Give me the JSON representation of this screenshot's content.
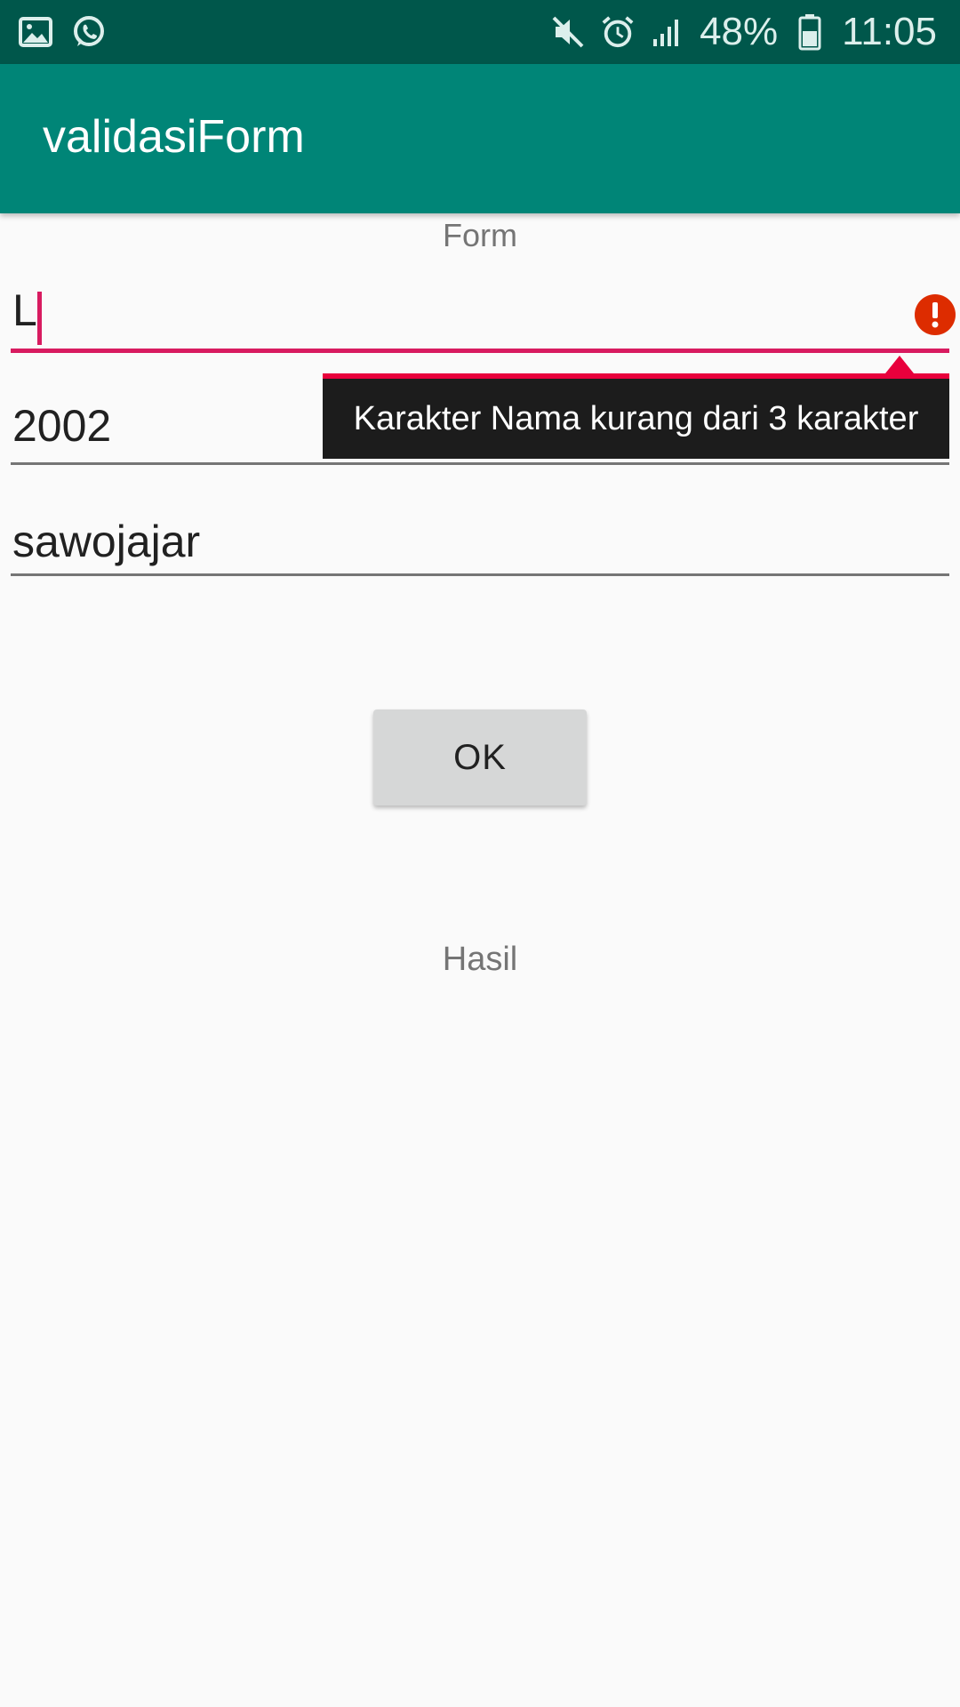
{
  "status_bar": {
    "battery_percent": "48%",
    "time": "11:05",
    "left_icons": [
      "gallery-icon",
      "whatsapp-icon"
    ],
    "right_icons": [
      "mute-icon",
      "alarm-icon",
      "signal-icon",
      "battery-icon"
    ]
  },
  "app_bar": {
    "title": "validasiForm",
    "color": "#008577"
  },
  "form": {
    "label": "Form",
    "name_field": {
      "value": "L"
    },
    "year_field": {
      "value": "2002"
    },
    "address_field": {
      "value": "sawojajar"
    },
    "error_tooltip": "Karakter Nama kurang dari 3 karakter",
    "ok_button": "OK",
    "result_label": "Hasil"
  },
  "colors": {
    "error": "#e8003c",
    "accent": "#d81b60"
  }
}
